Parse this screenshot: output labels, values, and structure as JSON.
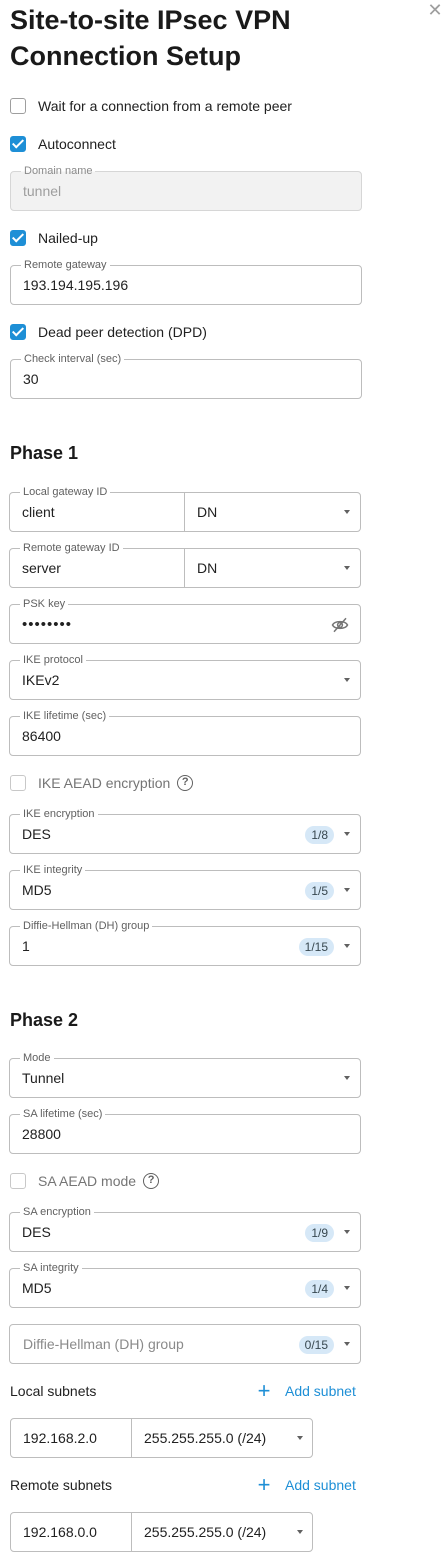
{
  "title": "Site-to-site IPsec VPN Connection Setup",
  "close_glyph": "✕",
  "general": {
    "wait_for_connection": {
      "label": "Wait for a connection from a remote peer",
      "checked": false
    },
    "autoconnect": {
      "label": "Autoconnect",
      "checked": true
    },
    "domain_name": {
      "label": "Domain name",
      "value": "tunnel",
      "disabled": true
    },
    "nailed_up": {
      "label": "Nailed-up",
      "checked": true
    },
    "remote_gateway": {
      "label": "Remote gateway",
      "value": "193.194.195.196"
    },
    "dpd": {
      "label": "Dead peer detection (DPD)",
      "checked": true
    },
    "check_interval": {
      "label": "Check interval (sec)",
      "value": "30"
    }
  },
  "phase1": {
    "heading": "Phase 1",
    "local_gateway_id": {
      "label": "Local gateway ID",
      "value": "client",
      "type": "DN"
    },
    "remote_gateway_id": {
      "label": "Remote gateway ID",
      "value": "server",
      "type": "DN"
    },
    "psk_key": {
      "label": "PSK key",
      "value": "••••••••"
    },
    "ike_protocol": {
      "label": "IKE protocol",
      "value": "IKEv2"
    },
    "ike_lifetime": {
      "label": "IKE lifetime (sec)",
      "value": "86400"
    },
    "ike_aead": {
      "label": "IKE AEAD encryption",
      "checked": false,
      "disabled": true,
      "help_glyph": "?"
    },
    "ike_encryption": {
      "label": "IKE encryption",
      "value": "DES",
      "count": "1/8"
    },
    "ike_integrity": {
      "label": "IKE integrity",
      "value": "MD5",
      "count": "1/5"
    },
    "dh_group": {
      "label": "Diffie-Hellman (DH) group",
      "value": "1",
      "count": "1/15"
    }
  },
  "phase2": {
    "heading": "Phase 2",
    "mode": {
      "label": "Mode",
      "value": "Tunnel"
    },
    "sa_lifetime": {
      "label": "SA lifetime (sec)",
      "value": "28800"
    },
    "sa_aead": {
      "label": "SA AEAD mode",
      "checked": false,
      "disabled": true,
      "help_glyph": "?"
    },
    "sa_encryption": {
      "label": "SA encryption",
      "value": "DES",
      "count": "1/9"
    },
    "sa_integrity": {
      "label": "SA integrity",
      "value": "MD5",
      "count": "1/4"
    },
    "dh_group": {
      "placeholder": "Diffie-Hellman (DH) group",
      "count": "0/15"
    },
    "local_subnets": {
      "label": "Local subnets",
      "add_label": "Add subnet",
      "add_glyph": "+",
      "items": [
        {
          "ip": "192.168.2.0",
          "mask": "255.255.255.0 (/24)"
        }
      ]
    },
    "remote_subnets": {
      "label": "Remote subnets",
      "add_label": "Add subnet",
      "add_glyph": "+",
      "items": [
        {
          "ip": "192.168.0.0",
          "mask": "255.255.255.0 (/24)"
        }
      ]
    }
  },
  "colors": {
    "accent": "#1e8fd6",
    "badge_bg": "#d6e8f7",
    "border": "#bdbdbd"
  },
  "icons": {
    "close": "close-icon",
    "checkbox": "check-icon",
    "dropdown": "chevron-down-icon",
    "visibility": "eye-off-icon",
    "help": "help-circle-icon",
    "add": "plus-icon"
  }
}
